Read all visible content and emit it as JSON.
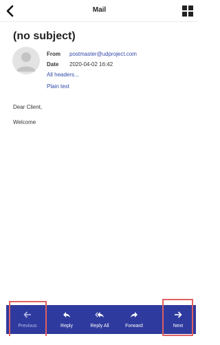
{
  "header": {
    "title": "Mail",
    "back_icon": "chevron-left-icon",
    "grid_icon": "grid-view-icon"
  },
  "message": {
    "subject": "(no subject)",
    "from_label": "From",
    "from_value": "postmaster@udproject.com",
    "date_label": "Date",
    "date_value": "2020-04-02 16:42",
    "all_headers_link": "All headers...",
    "plain_text_link": "Plain text",
    "body_lines": [
      "Dear Client,",
      "Welcome"
    ]
  },
  "toolbar": {
    "items": [
      {
        "label": "Previous",
        "icon": "arrow-left-icon"
      },
      {
        "label": "Reply",
        "icon": "reply-icon"
      },
      {
        "label": "Reply All",
        "icon": "reply-all-icon"
      },
      {
        "label": "Forward",
        "icon": "forward-icon"
      },
      {
        "label": "Next",
        "icon": "arrow-right-icon"
      }
    ]
  },
  "colors": {
    "toolbar_bg": "#2f3a9e",
    "link": "#3048a8",
    "highlight": "#e06060"
  }
}
